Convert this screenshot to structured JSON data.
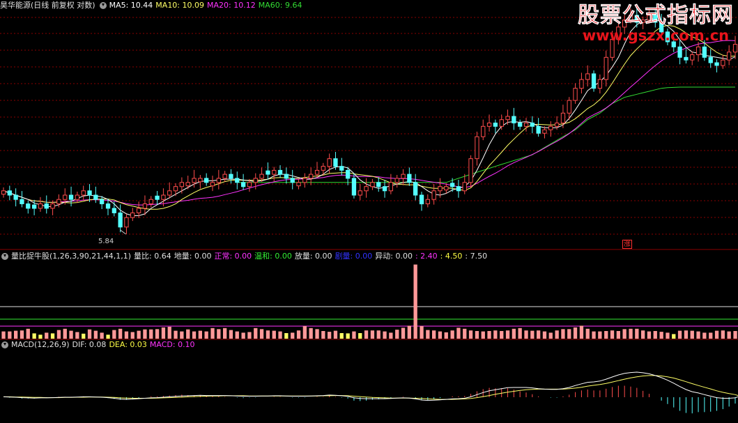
{
  "header": {
    "title": "昊华能源(日线 前复权 对数)",
    "ma": [
      {
        "label": "MA5: 10.44",
        "color": "#ffffff"
      },
      {
        "label": "MA10: 10.09",
        "color": "#ffff66"
      },
      {
        "label": "MA20: 10.12",
        "color": "#ff33ff"
      },
      {
        "label": "MA60: 9.64",
        "color": "#33dd33"
      }
    ]
  },
  "watermark": {
    "title": "股票公式指标网",
    "url": "www.gszx.com.cn"
  },
  "price_panel": {
    "low_label": "5.84",
    "limit_up_badge": "涨"
  },
  "volume_panel": {
    "title": "量比捉牛股(1,26,3,90,21,44,1,1)",
    "items": [
      {
        "label": "量比: 0.64",
        "color": "#e0e0e0"
      },
      {
        "label": "地量: 0.00",
        "color": "#e0e0e0"
      },
      {
        "label": "正常: 0.00",
        "color": "#ff33ff"
      },
      {
        "label": "温和: 0.00",
        "color": "#33ee33"
      },
      {
        "label": "放量: 0.00",
        "color": "#e0e0e0"
      },
      {
        "label": "剧量: 0.00",
        "color": "#3333ff"
      },
      {
        "label": "异动: 0.00",
        "color": "#e0e0e0"
      },
      {
        "label": ": 2.40",
        "color": "#ff33ff"
      },
      {
        "label": ": 4.50",
        "color": "#ffff44"
      },
      {
        "label": ": 7.50",
        "color": "#e0e0e0"
      }
    ]
  },
  "macd_panel": {
    "title": "MACD(12,26,9)",
    "items": [
      {
        "label": "DIF: 0.08",
        "color": "#e0e0e0"
      },
      {
        "label": "DEA: 0.03",
        "color": "#ffff44"
      },
      {
        "label": "MACD: 0.10",
        "color": "#ff33ff"
      }
    ]
  },
  "colors": {
    "up": "#ff4d4d",
    "down": "#54ffff",
    "vol_up": "#ff9999",
    "vol_low": "#ffff66",
    "ma5": "#ffffff",
    "ma10": "#ffff66",
    "ma20": "#ff33ff",
    "ma60": "#33dd33",
    "grid": "#8b0000"
  },
  "chart_data": {
    "type": "candlestick",
    "price_scale": "log",
    "close": [
      6.7,
      6.6,
      6.5,
      6.4,
      6.3,
      6.3,
      6.4,
      6.3,
      6.4,
      6.5,
      6.6,
      6.5,
      6.6,
      6.7,
      6.6,
      6.5,
      6.4,
      6.3,
      6.2,
      5.9,
      6.1,
      6.2,
      6.3,
      6.4,
      6.5,
      6.5,
      6.6,
      6.7,
      6.8,
      6.9,
      6.9,
      7.0,
      7.0,
      6.9,
      6.9,
      7.0,
      7.1,
      7.0,
      6.9,
      6.8,
      6.9,
      7.0,
      7.1,
      7.1,
      7.2,
      7.1,
      7.0,
      6.9,
      6.9,
      7.0,
      7.1,
      7.2,
      7.3,
      7.5,
      7.3,
      7.2,
      7.0,
      6.6,
      6.7,
      6.8,
      6.9,
      6.8,
      6.7,
      6.9,
      7.0,
      7.1,
      6.9,
      6.6,
      6.4,
      6.5,
      6.7,
      6.8,
      6.8,
      6.8,
      6.7,
      6.9,
      7.5,
      8.1,
      8.4,
      8.5,
      8.4,
      8.6,
      8.7,
      8.5,
      8.4,
      8.5,
      8.4,
      8.2,
      8.3,
      8.4,
      8.5,
      8.8,
      9.2,
      9.6,
      9.9,
      10.1,
      9.6,
      9.9,
      10.7,
      11.4,
      11.9,
      12.2,
      12.4,
      12.1,
      12.2,
      12.4,
      12.1,
      11.7,
      11.3,
      11.1,
      10.7,
      10.6,
      10.8,
      11.1,
      10.7,
      10.5,
      10.4,
      10.6,
      10.9,
      11.2
    ],
    "ma60": [
      6.9,
      6.9,
      6.9,
      6.9,
      6.9,
      6.9,
      6.9,
      6.9,
      6.9,
      6.9,
      6.9,
      6.9,
      6.9,
      6.9,
      6.9,
      6.9,
      6.9,
      6.9,
      6.9,
      6.9,
      6.9,
      6.9,
      6.9,
      6.9,
      6.9,
      6.9,
      6.9,
      6.9,
      6.9,
      6.9,
      6.9,
      6.9,
      6.9,
      6.9,
      6.9,
      6.9,
      6.9,
      6.9,
      6.9,
      6.9,
      6.9,
      6.9,
      6.9,
      6.9,
      6.9,
      6.9,
      6.9,
      6.9,
      6.9,
      6.9,
      6.9,
      6.9,
      6.9,
      6.9,
      6.9,
      6.9,
      6.9,
      6.9,
      6.9,
      6.9,
      6.9,
      6.9,
      6.9,
      6.9,
      6.9,
      6.9,
      6.9,
      6.9,
      6.9,
      6.9,
      6.9,
      6.9,
      6.9,
      6.95,
      7.0,
      7.05,
      7.1,
      7.15,
      7.2,
      7.25,
      7.3,
      7.35,
      7.4,
      7.45,
      7.5,
      7.55,
      7.6,
      7.7,
      7.8,
      7.9,
      8.0,
      8.1,
      8.2,
      8.3,
      8.45,
      8.6,
      8.7,
      8.8,
      8.95,
      9.1,
      9.2,
      9.3,
      9.35,
      9.4,
      9.45,
      9.5,
      9.55,
      9.6,
      9.62,
      9.63,
      9.64,
      9.64,
      9.64,
      9.64,
      9.64,
      9.64,
      9.64,
      9.64,
      9.64,
      9.64
    ],
    "volume_ratio": [
      0.55,
      0.55,
      0.6,
      0.62,
      0.75,
      0.4,
      0.3,
      0.45,
      0.4,
      0.65,
      0.75,
      0.6,
      0.5,
      0.38,
      0.7,
      0.6,
      0.45,
      0.3,
      0.65,
      0.75,
      0.55,
      0.5,
      0.6,
      0.7,
      0.7,
      0.72,
      0.85,
      0.9,
      0.6,
      0.55,
      0.7,
      0.55,
      0.6,
      0.55,
      0.8,
      0.72,
      0.8,
      0.65,
      0.55,
      0.45,
      0.5,
      0.8,
      0.72,
      0.62,
      0.6,
      0.55,
      0.42,
      0.45,
      0.62,
      0.95,
      0.8,
      0.72,
      0.58,
      0.52,
      0.6,
      0.42,
      0.4,
      0.55,
      0.42,
      0.62,
      0.62,
      0.62,
      0.55,
      0.45,
      0.68,
      0.82,
      0.98,
      5.6,
      0.95,
      0.65,
      0.62,
      0.55,
      0.48,
      0.62,
      0.82,
      0.75,
      0.62,
      0.58,
      0.55,
      0.58,
      0.62,
      0.58,
      0.62,
      0.75,
      0.8,
      0.62,
      0.6,
      0.62,
      0.55,
      0.45,
      0.62,
      0.72,
      0.72,
      0.85,
      0.98,
      0.75,
      0.55,
      0.55,
      0.58,
      0.62,
      0.58,
      0.72,
      0.75,
      0.75,
      0.62,
      0.55,
      0.58,
      0.52,
      0.45,
      0.35,
      0.6,
      0.62,
      0.6,
      0.55,
      0.45,
      0.45,
      0.6,
      0.62,
      0.55,
      0.58
    ],
    "volume_ref_lines": [
      {
        "name": "2.40",
        "value": 2.4
      },
      {
        "name": "4.50",
        "value": 4.5
      },
      {
        "name": "7.50",
        "value": 7.5
      }
    ],
    "dif": [
      0.02,
      0.01,
      0.0,
      -0.02,
      -0.03,
      -0.04,
      -0.03,
      -0.03,
      -0.02,
      -0.01,
      0.0,
      0.0,
      0.01,
      0.02,
      0.02,
      0.01,
      0.0,
      -0.02,
      -0.05,
      -0.09,
      -0.1,
      -0.09,
      -0.07,
      -0.05,
      -0.03,
      -0.02,
      0.0,
      0.02,
      0.04,
      0.06,
      0.07,
      0.08,
      0.09,
      0.08,
      0.08,
      0.08,
      0.08,
      0.07,
      0.06,
      0.05,
      0.05,
      0.05,
      0.06,
      0.06,
      0.07,
      0.07,
      0.06,
      0.05,
      0.05,
      0.05,
      0.06,
      0.07,
      0.08,
      0.1,
      0.09,
      0.07,
      0.04,
      -0.03,
      -0.06,
      -0.07,
      -0.07,
      -0.07,
      -0.07,
      -0.06,
      -0.04,
      -0.03,
      -0.04,
      -0.08,
      -0.13,
      -0.15,
      -0.14,
      -0.12,
      -0.1,
      -0.08,
      -0.07,
      -0.05,
      0.02,
      0.12,
      0.22,
      0.3,
      0.35,
      0.4,
      0.45,
      0.46,
      0.46,
      0.46,
      0.44,
      0.4,
      0.38,
      0.37,
      0.37,
      0.4,
      0.46,
      0.55,
      0.63,
      0.7,
      0.72,
      0.76,
      0.85,
      0.95,
      1.05,
      1.12,
      1.16,
      1.18,
      1.15,
      1.1,
      1.02,
      0.92,
      0.8,
      0.66,
      0.5,
      0.36,
      0.26,
      0.2,
      0.12,
      0.05,
      -0.02,
      -0.05,
      -0.05,
      -0.03,
      0.08
    ],
    "dea": [
      0.02,
      0.02,
      0.01,
      0.01,
      0.0,
      -0.01,
      -0.01,
      -0.02,
      -0.02,
      -0.02,
      -0.01,
      -0.01,
      0.0,
      0.0,
      0.01,
      0.01,
      0.01,
      0.0,
      -0.01,
      -0.03,
      -0.04,
      -0.05,
      -0.05,
      -0.05,
      -0.05,
      -0.04,
      -0.03,
      -0.02,
      -0.01,
      0.0,
      0.02,
      0.03,
      0.04,
      0.05,
      0.06,
      0.06,
      0.07,
      0.07,
      0.07,
      0.07,
      0.06,
      0.06,
      0.06,
      0.06,
      0.06,
      0.06,
      0.06,
      0.06,
      0.06,
      0.06,
      0.06,
      0.06,
      0.07,
      0.07,
      0.08,
      0.08,
      0.07,
      0.05,
      0.03,
      0.01,
      -0.01,
      -0.02,
      -0.03,
      -0.04,
      -0.04,
      -0.04,
      -0.04,
      -0.05,
      -0.06,
      -0.08,
      -0.09,
      -0.1,
      -0.1,
      -0.1,
      -0.09,
      -0.08,
      -0.06,
      -0.02,
      0.03,
      0.08,
      0.14,
      0.19,
      0.24,
      0.28,
      0.32,
      0.35,
      0.37,
      0.38,
      0.38,
      0.38,
      0.38,
      0.38,
      0.4,
      0.43,
      0.47,
      0.52,
      0.56,
      0.6,
      0.65,
      0.71,
      0.78,
      0.85,
      0.91,
      0.96,
      1.0,
      1.02,
      1.02,
      1.0,
      0.96,
      0.9,
      0.82,
      0.73,
      0.64,
      0.55,
      0.47,
      0.39,
      0.3,
      0.23,
      0.17,
      0.12,
      0.03
    ]
  }
}
